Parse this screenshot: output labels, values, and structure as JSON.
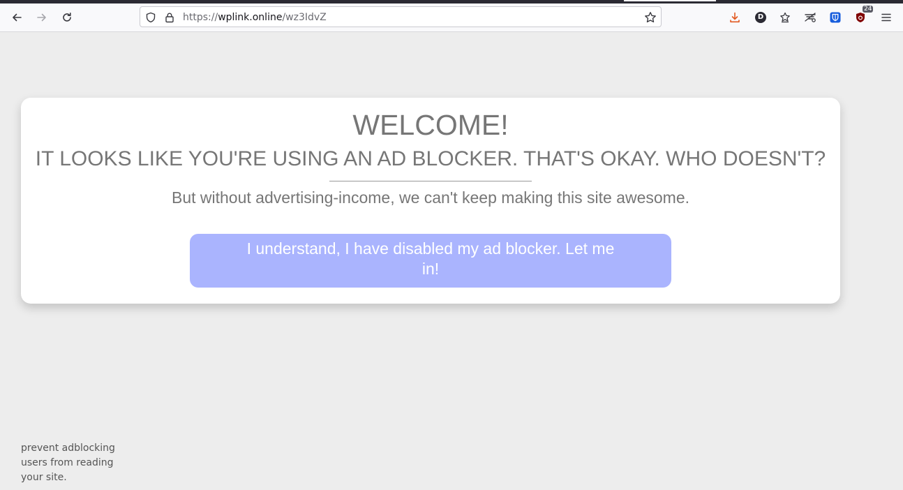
{
  "browser": {
    "url_scheme": "https://",
    "url_host": "wplink.online",
    "url_path": "/wz3IdvZ",
    "extension_badge": "24",
    "profile_letter": "D"
  },
  "page": {
    "title": "WELCOME!",
    "subtitle": "IT LOOKS LIKE YOU'RE USING AN AD BLOCKER. THAT'S OKAY. WHO DOESN'T?",
    "body": "But without advertising-income, we can't keep making this site awesome.",
    "cta_label": "I understand, I have disabled my ad blocker. Let me in!",
    "footer_note": "prevent adblocking users from reading your site."
  },
  "colors": {
    "cta_background": "#aab4fe",
    "text_gray": "#767676",
    "page_background": "#ededed",
    "download_icon": "#e25920",
    "bitwarden_icon": "#175ddc",
    "ublock_icon": "#800000"
  }
}
